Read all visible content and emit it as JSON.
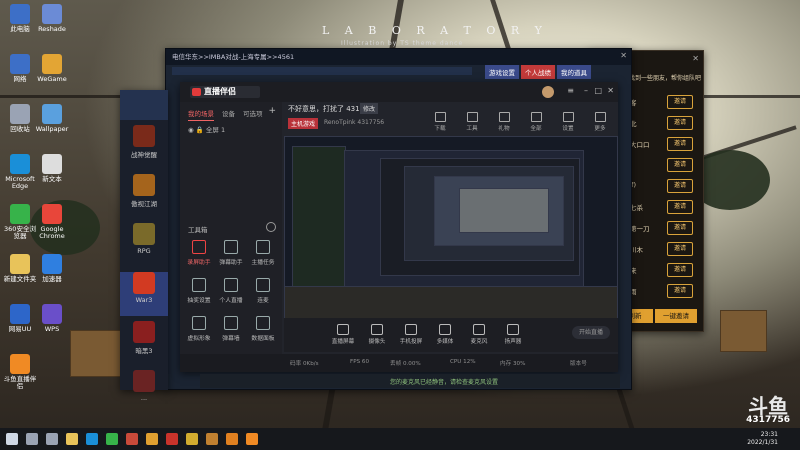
{
  "wallpaper": {
    "title": "L A B O R A T O R Y",
    "subtitle": "Illustration by TS theme dance"
  },
  "desktop_icons": [
    {
      "label": "此电脑",
      "color": "#3d6fc7"
    },
    {
      "label": "Reshade",
      "color": "#6b8bd6"
    },
    {
      "label": "网络",
      "color": "#3d6fc7"
    },
    {
      "label": "WeGame",
      "color": "#e3a534"
    },
    {
      "label": "回收站",
      "color": "#9aa3b4"
    },
    {
      "label": "Wallpaper",
      "color": "#5aa0de"
    },
    {
      "label": "Microsoft Edge",
      "color": "#1a8fd8"
    },
    {
      "label": "新文本",
      "color": "#dddddd"
    },
    {
      "label": "360安全浏览器",
      "color": "#37b34a"
    },
    {
      "label": "Google Chrome",
      "color": "#e8463a"
    },
    {
      "label": "新建文件夹",
      "color": "#e8c35a"
    },
    {
      "label": "加速器",
      "color": "#2f7fe0"
    },
    {
      "label": "网易UU",
      "color": "#2d66c9"
    },
    {
      "label": "WPS",
      "color": "#6a4fc9"
    },
    {
      "label": "斗鱼直播伴侣",
      "color": "#f08a24"
    }
  ],
  "game_panel": {
    "items": [
      {
        "label": "战神觉醒",
        "color": "#7a2a1a"
      },
      {
        "label": "傲视江湖",
        "color": "#a5641c"
      },
      {
        "label": "RPG",
        "color": "#7a6a2a"
      },
      {
        "label": "War3",
        "color": "#d23a22",
        "active": true
      },
      {
        "label": "暗黑3",
        "color": "#8a1f1f"
      },
      {
        "label": "...",
        "color": "#6a2323"
      }
    ]
  },
  "chat_window": {
    "rows": [
      {
        "label": "李过客",
        "button": "邀请"
      },
      {
        "label": "凤凰北",
        "button": "邀请"
      },
      {
        "label": "落落大口口",
        "button": "邀请"
      },
      {
        "label": "夜宁",
        "button": "邀请"
      },
      {
        "label": "qq(sf)",
        "button": "邀请"
      },
      {
        "label": "霸王七杀",
        "button": "邀请"
      },
      {
        "label": "江湖第一刀",
        "button": "邀请"
      },
      {
        "label": "黎明川木",
        "button": "邀请"
      },
      {
        "label": "醉仙来",
        "button": "邀请"
      },
      {
        "label": "暴风雨",
        "button": "邀请"
      }
    ],
    "header_text": "为你找到一些朋友，帮你组队吧",
    "footer_left": "刷新",
    "footer_right": "一键邀请"
  },
  "game_window": {
    "title": "电信华东>>IMBA对战-上海专属>>4561",
    "tabs": [
      "游戏设置",
      "个人战绩",
      "我的道具"
    ]
  },
  "app": {
    "logo": "直播伴侣",
    "left_tabs": [
      {
        "label": "我的场景",
        "selected": true
      },
      {
        "label": "设备",
        "selected": false
      },
      {
        "label": "可选项",
        "selected": false
      }
    ],
    "scene": "全屏 1",
    "tools_title": "工具箱",
    "tools": [
      {
        "label": "录屏助手",
        "red": true
      },
      {
        "label": "弹幕助手",
        "red": false
      },
      {
        "label": "主播任务",
        "red": false
      },
      {
        "label": "抽奖设置",
        "red": false
      },
      {
        "label": "个人直播",
        "red": false
      },
      {
        "label": "连麦",
        "red": false
      },
      {
        "label": "虚拟形象",
        "red": false
      },
      {
        "label": "弹幕墙",
        "red": false
      },
      {
        "label": "数据面板",
        "red": false
      }
    ],
    "header": {
      "title": "不好意思，打扰了 4317756",
      "edit": "修改",
      "tag": "主机游戏",
      "meta": "RenoTpink  4317756",
      "items": [
        "下载",
        "工具",
        "礼物",
        "全部",
        "设置",
        "更多"
      ]
    },
    "bottom": {
      "items": [
        "直播屏幕",
        "摄像头",
        "手机投屏",
        "多媒体",
        "麦克风",
        "扬声器"
      ],
      "start_label": "开始直播"
    },
    "status": {
      "bitrate": "码率 0Kb/s",
      "fps": "FPS 60",
      "dropped": "丢帧 0.00%",
      "cpu": "CPU 12%",
      "memory": "内存 30%",
      "version": "版本号"
    }
  },
  "notice": {
    "text": "您的麦克风已经静音，请检查麦克风设置"
  },
  "overlay": {
    "logo": "斗鱼",
    "room": "4317756"
  },
  "taskbar": {
    "time": "23:31",
    "date": "2022/1/31",
    "icons": [
      {
        "name": "start",
        "color": "#cfd8e6"
      },
      {
        "name": "search",
        "color": "#9aa3b4"
      },
      {
        "name": "taskview",
        "color": "#9aa3b4"
      },
      {
        "name": "explorer",
        "color": "#e8c35a"
      },
      {
        "name": "edge",
        "color": "#1a8fd8"
      },
      {
        "name": "wechat",
        "color": "#37b34a"
      },
      {
        "name": "app1",
        "color": "#c94a3a"
      },
      {
        "name": "app2",
        "color": "#e0a030"
      },
      {
        "name": "app3",
        "color": "#c9332b"
      },
      {
        "name": "app4",
        "color": "#d2ac2f"
      },
      {
        "name": "app5",
        "color": "#c08030"
      },
      {
        "name": "app6",
        "color": "#e08020"
      },
      {
        "name": "app7",
        "color": "#f08a24"
      }
    ]
  }
}
